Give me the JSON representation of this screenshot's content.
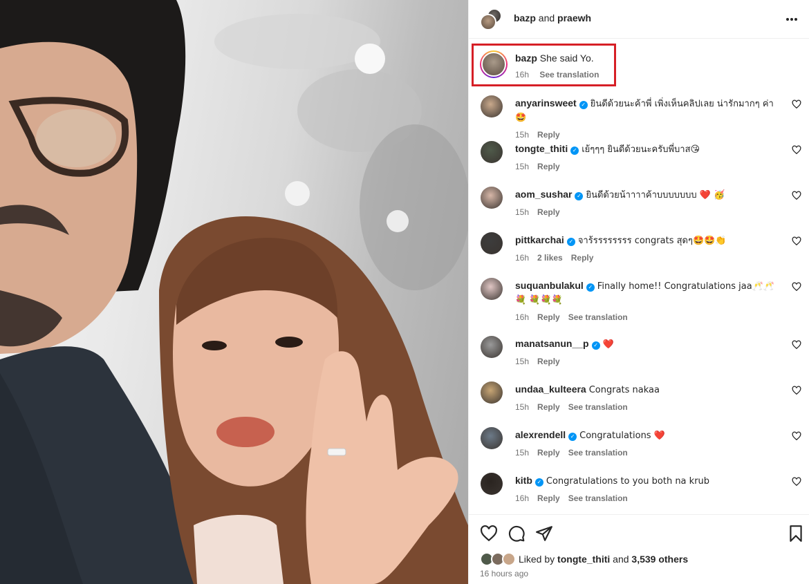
{
  "header": {
    "user1": "bazp",
    "joiner": "and",
    "user2": "praewh"
  },
  "caption": {
    "username": "bazp",
    "text": "She said Yo.",
    "time": "16h",
    "translate": "See translation"
  },
  "comments": [
    {
      "username": "anyarinsweet",
      "verified": true,
      "text": "ยินดีด้วยนะค้าพี่ เพิ่งเห็นคลิปเลย น่ารักมากๆ ค่า🤩",
      "time": "15h",
      "likes": "",
      "reply": "Reply",
      "translate": "",
      "avatar_color": "#c9a98c"
    },
    {
      "username": "tongte_thiti",
      "verified": true,
      "text": "เย้ๆๆๆ ยินดีด้วยนะครับพี่บาส😘",
      "time": "15h",
      "likes": "",
      "reply": "Reply",
      "translate": "",
      "avatar_color": "#4f5a4a"
    },
    {
      "username": "aom_sushar",
      "verified": true,
      "text": "ยินดีด้วยน้าาาาค้าบบบบบบบ ❤️ 🥳",
      "time": "15h",
      "likes": "",
      "reply": "Reply",
      "translate": "",
      "avatar_color": "#d7b7a8"
    },
    {
      "username": "pittkarchai",
      "verified": true,
      "text": "จาร้รรรรรรรร congrats สุดๆ🤩🤩👏",
      "time": "16h",
      "likes": "2 likes",
      "reply": "Reply",
      "translate": "",
      "avatar_color": "#3c3c3c"
    },
    {
      "username": "suquanbulakul",
      "verified": true,
      "text": "Finally home!! Congratulations jaa🥂🥂💐 💐💐💐",
      "time": "16h",
      "likes": "",
      "reply": "Reply",
      "translate": "See translation",
      "avatar_color": "#e0c6c4"
    },
    {
      "username": "manatsanun__p",
      "verified": true,
      "text": "❤️",
      "time": "15h",
      "likes": "",
      "reply": "Reply",
      "translate": "",
      "avatar_color": "#9a9a9a"
    },
    {
      "username": "undaa_kulteera",
      "verified": false,
      "text": "Congrats nakaa",
      "time": "15h",
      "likes": "",
      "reply": "Reply",
      "translate": "See translation",
      "avatar_color": "#c7a574"
    },
    {
      "username": "alexrendell",
      "verified": true,
      "text": "Congratulations ❤️",
      "time": "15h",
      "likes": "",
      "reply": "Reply",
      "translate": "See translation",
      "avatar_color": "#6c7a88"
    },
    {
      "username": "kitb",
      "verified": true,
      "text": "Congratulations to you both na krub",
      "time": "16h",
      "likes": "",
      "reply": "Reply",
      "translate": "See translation",
      "avatar_color": "#2a2420"
    }
  ],
  "likes": {
    "prefix": "Liked by",
    "user": "tongte_thiti",
    "joiner": "and",
    "others": "3,539 others"
  },
  "posted": "16 hours ago",
  "icons": [
    "more-icon",
    "heart-icon",
    "comment-icon",
    "share-icon",
    "bookmark-icon",
    "verified-icon"
  ],
  "colors": {
    "verified": "#0095f6",
    "highlight_border": "#d61f26",
    "text_secondary": "#737373"
  }
}
